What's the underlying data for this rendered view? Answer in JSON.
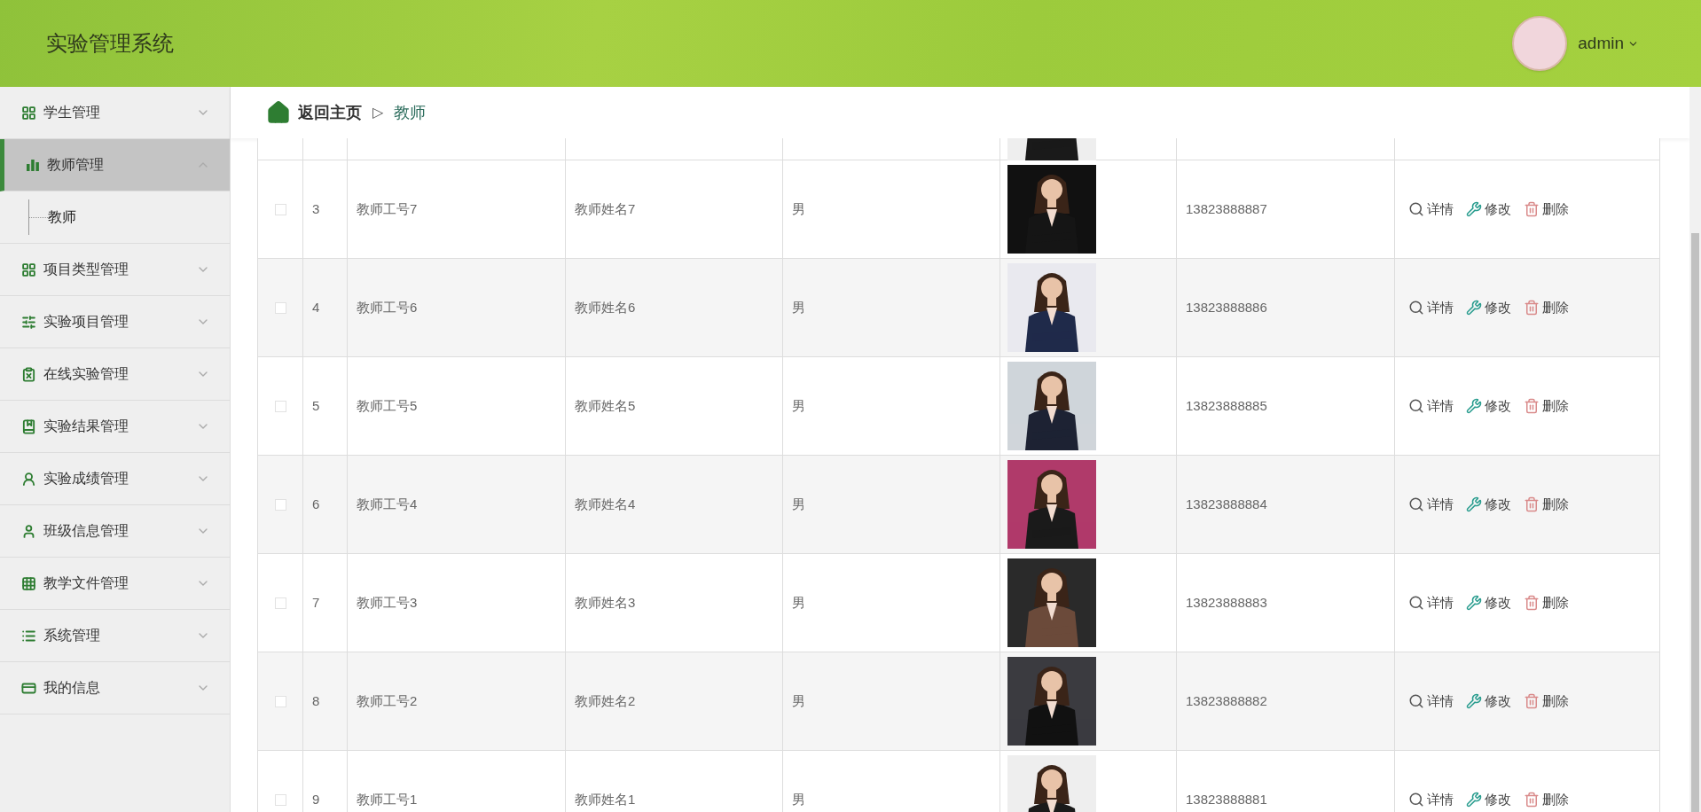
{
  "header": {
    "title": "实验管理系统",
    "user": "admin"
  },
  "sidebar": {
    "items": [
      {
        "label": "学生管理",
        "expanded": false,
        "selected": false
      },
      {
        "label": "教师管理",
        "expanded": true,
        "selected": true,
        "children": [
          {
            "label": "教师"
          }
        ]
      },
      {
        "label": "项目类型管理",
        "expanded": false,
        "selected": false
      },
      {
        "label": "实验项目管理",
        "expanded": false,
        "selected": false
      },
      {
        "label": "在线实验管理",
        "expanded": false,
        "selected": false
      },
      {
        "label": "实验结果管理",
        "expanded": false,
        "selected": false
      },
      {
        "label": "实验成绩管理",
        "expanded": false,
        "selected": false
      },
      {
        "label": "班级信息管理",
        "expanded": false,
        "selected": false
      },
      {
        "label": "教学文件管理",
        "expanded": false,
        "selected": false
      },
      {
        "label": "系统管理",
        "expanded": false,
        "selected": false
      },
      {
        "label": "我的信息",
        "expanded": false,
        "selected": false
      }
    ]
  },
  "breadcrumb": {
    "home": "返回主页",
    "separator": "▷",
    "current": "教师"
  },
  "table": {
    "rows": [
      {
        "checked": false,
        "index": "3",
        "teacher_id": "教师工号7",
        "teacher_name": "教师姓名7",
        "gender": "男",
        "phone": "13823888887",
        "actions": [
          "详情",
          "修改",
          "删除"
        ]
      },
      {
        "checked": false,
        "index": "4",
        "teacher_id": "教师工号6",
        "teacher_name": "教师姓名6",
        "gender": "男",
        "phone": "13823888886",
        "actions": [
          "详情",
          "修改",
          "删除"
        ]
      },
      {
        "checked": false,
        "index": "5",
        "teacher_id": "教师工号5",
        "teacher_name": "教师姓名5",
        "gender": "男",
        "phone": "13823888885",
        "actions": [
          "详情",
          "修改",
          "删除"
        ]
      },
      {
        "checked": false,
        "index": "6",
        "teacher_id": "教师工号4",
        "teacher_name": "教师姓名4",
        "gender": "男",
        "phone": "13823888884",
        "actions": [
          "详情",
          "修改",
          "删除"
        ]
      },
      {
        "checked": false,
        "index": "7",
        "teacher_id": "教师工号3",
        "teacher_name": "教师姓名3",
        "gender": "男",
        "phone": "13823888883",
        "actions": [
          "详情",
          "修改",
          "删除"
        ]
      },
      {
        "checked": false,
        "index": "8",
        "teacher_id": "教师工号2",
        "teacher_name": "教师姓名2",
        "gender": "男",
        "phone": "13823888882",
        "actions": [
          "详情",
          "修改",
          "删除"
        ]
      },
      {
        "checked": false,
        "index": "9",
        "teacher_id": "教师工号1",
        "teacher_name": "教师姓名1",
        "gender": "男",
        "phone": "13823888881",
        "actions": [
          "详情",
          "修改",
          "删除"
        ]
      }
    ]
  }
}
